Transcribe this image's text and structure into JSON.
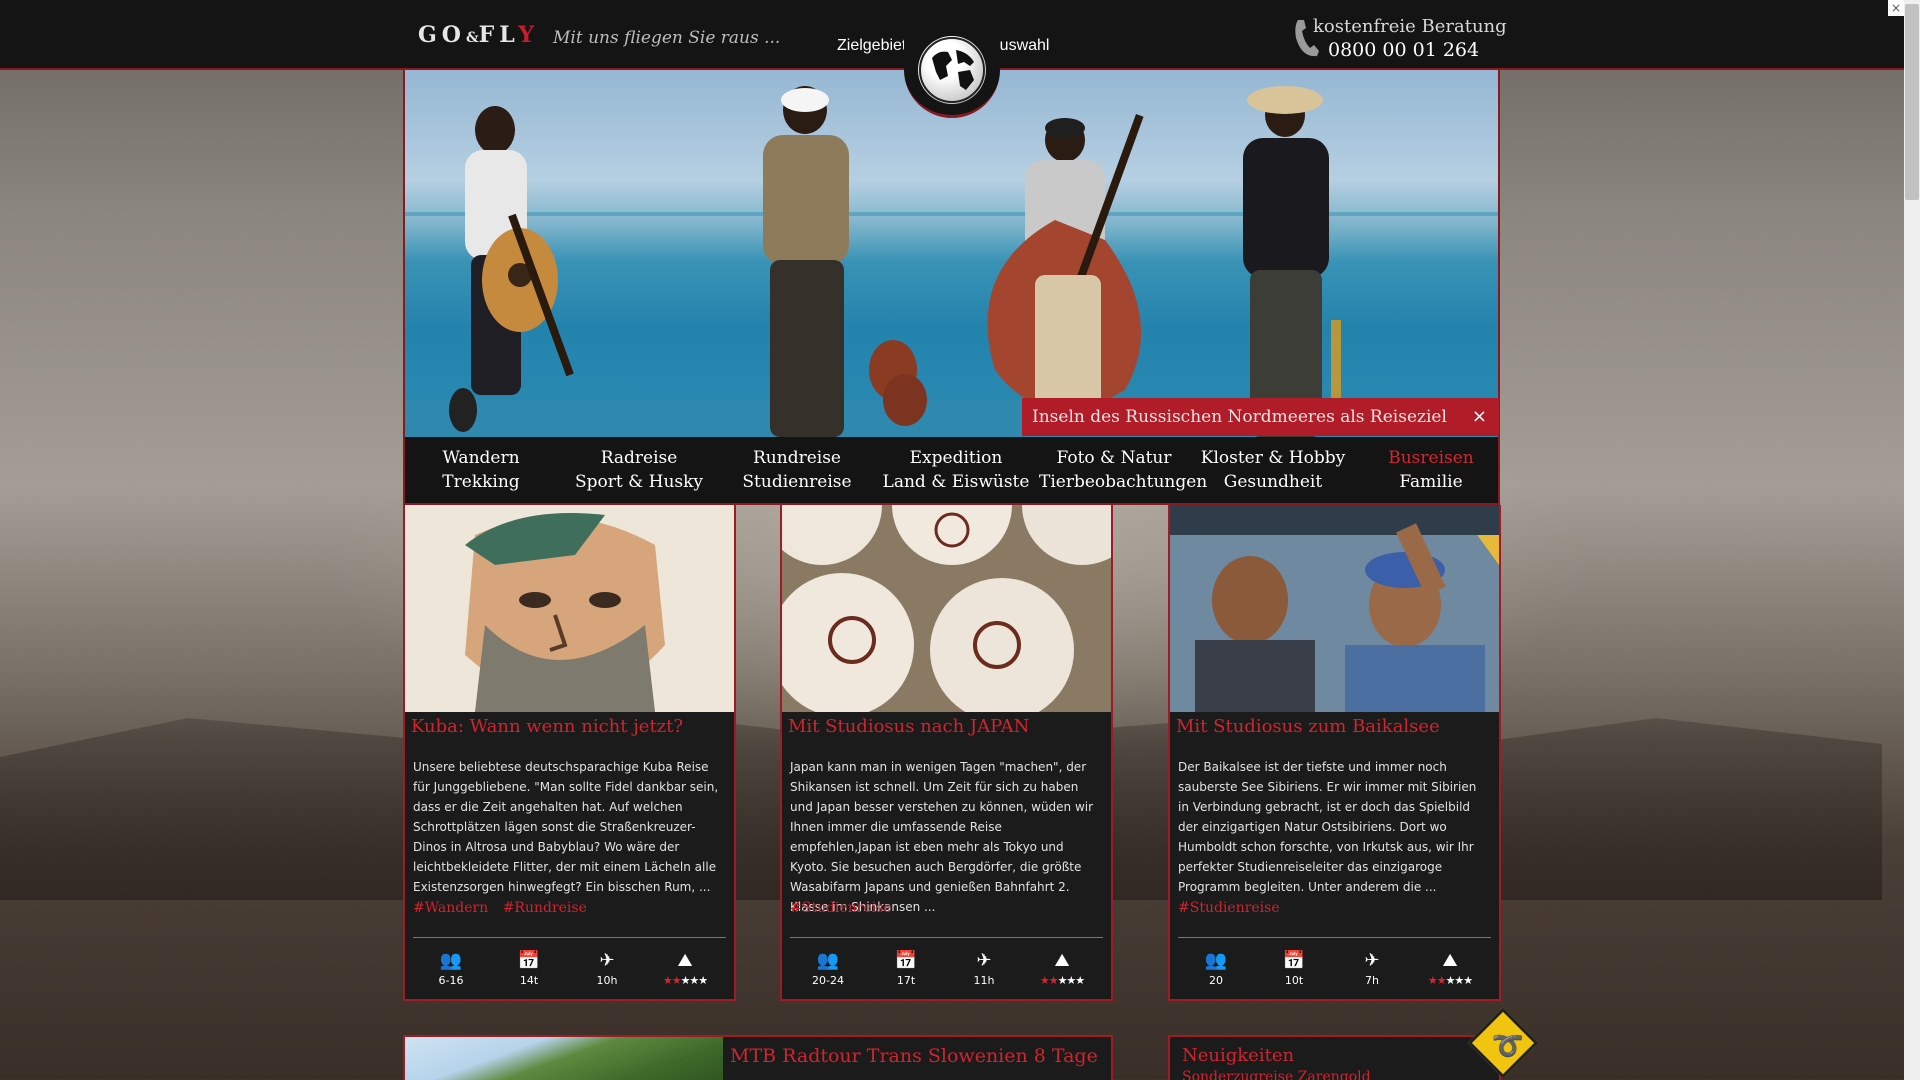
{
  "header": {
    "logo_text": "GO",
    "logo_amp": "&",
    "logo_fl": "FL",
    "logo_y": "Y",
    "tagline": "Mit uns fliegen Sie raus ...",
    "nav_destination": "Zielgebiets",
    "nav_selection": "Auswahl",
    "phone_label": "kostenfreie Beratung",
    "phone_number": "0800 00 01 264",
    "close_glyph": "×"
  },
  "hero": {
    "notice": "Inseln des Russischen Nordmeeres als Reiseziel entfernen",
    "notice_close": "×"
  },
  "categories": [
    {
      "line1": "Wandern",
      "line2": "Trekking"
    },
    {
      "line1": "Radreise",
      "line2": "Sport & Husky"
    },
    {
      "line1": "Rundreise",
      "line2": "Studienreise"
    },
    {
      "line1": "Expedition",
      "line2": "Land & Eiswüste"
    },
    {
      "line1": "Foto & Natur",
      "line2": "Tierbeobachtungen"
    },
    {
      "line1": "Kloster & Hobby",
      "line2": "Gesundheit"
    },
    {
      "line1": "Busreisen",
      "line2": "Familie",
      "active": true
    }
  ],
  "cards": [
    {
      "title": "Kuba: Wann wenn nicht jetzt?",
      "text": "Unsere beliebtese deutschsparachige Kuba Reise für Junggebliebene. \"Man sollte Fidel dankbar sein, dass er die Zeit angehalten hat. Auf welchen Schrottplätzen lägen sonst die Straßenkreuzer-Dinos in Altrosa und Babyblau? Wo wäre der leichtbekleidete Flitter, der mit einem Lächeln alle Existenzsorgen hinwegfegt? Ein bisschen Rum, ...",
      "tags": [
        "#Wandern",
        "#Rundreise"
      ],
      "group": "6-16",
      "days": "14t",
      "flight": "10h",
      "rating_red": "★★",
      "rating_white": "★★★"
    },
    {
      "title": "Mit Studiosus nach JAPAN",
      "text": "Japan kann man in wenigen Tagen \"machen\", der Shikansen ist schnell. Um Zeit für sich zu haben und Japan besser verstehen zu können, wüden wir Ihnen immer die umfassende Reise empfehlen,Japan ist eben mehr als Tokyo und Kyoto. Sie besuchen auch Bergdörfer, die größte Wasabifarm Japans und genießen Bahnfahrt 2. Klasse im Shinkansen ...",
      "tags": [
        "#Studienreise"
      ],
      "group": "20-24",
      "days": "17t",
      "flight": "11h",
      "rating_red": "★★",
      "rating_white": "★★★"
    },
    {
      "title": "Mit Studiosus zum Baikalsee",
      "text": "Der Baikalsee ist der tiefste und immer noch sauberste See Sibiriens. Er wir immer mit Sibirien in Verbindung gebracht, ist er doch das Spielbild der einzigartigen Natur Ostsibiriens. Dort wo Humboldt schon forschte, von Irkutsk aus, wir Ihr perfekter Studienreiseleiter das einzigaroge Programm begleiten. Unter anderem die ...",
      "tags": [
        "#Studienreise"
      ],
      "group": "20",
      "days": "10t",
      "flight": "7h",
      "rating_red": "★★",
      "rating_white": "★★★"
    }
  ],
  "feature": {
    "title": "MTB Radtour Trans Slowenien 8 Tage"
  },
  "news": {
    "title": "Neuigkeiten",
    "sub": "Sonderzugreise Zarengold"
  },
  "icons": {
    "group": "👥",
    "calendar": "📅",
    "plane": "✈",
    "mountain": "⛰",
    "road": "➰"
  },
  "colors": {
    "accent": "#d1242e",
    "dark": "#141414"
  }
}
